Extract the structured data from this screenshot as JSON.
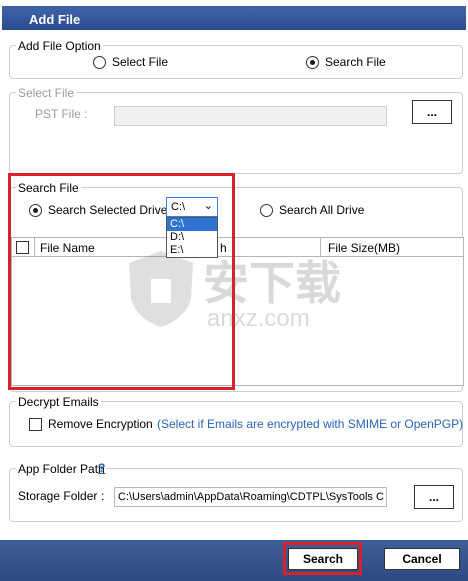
{
  "window": {
    "title": "Add File"
  },
  "add_file_option": {
    "legend": "Add File Option",
    "select_file_label": "Select File",
    "search_file_label": "Search File"
  },
  "select_file": {
    "legend": "Select File",
    "pst_label": "PST File :",
    "browse_label": "..."
  },
  "search_file": {
    "legend": "Search File",
    "search_selected_drive_label": "Search Selected Drive",
    "search_all_drive_label": "Search All Drive",
    "drive_selected": "C:\\",
    "drive_options": [
      "C:\\",
      "D:\\",
      "E:\\"
    ],
    "columns": {
      "file_name": "File Name",
      "col2": "h",
      "file_size": "File Size(MB)"
    }
  },
  "decrypt_emails": {
    "legend": "Decrypt Emails",
    "remove_encryption_label": "Remove Encryption",
    "note": "(Select if Emails are encrypted with SMIME or OpenPGP)"
  },
  "app_folder": {
    "legend": "App Folder Path",
    "help_mark": "?",
    "storage_label": "Storage Folder",
    "colon": ":",
    "path_value": "C:\\Users\\admin\\AppData\\Roaming\\CDTPL\\SysTools C",
    "browse_label": "..."
  },
  "buttons": {
    "search": "Search",
    "cancel": "Cancel"
  },
  "watermark": {
    "text_cn": "安下载",
    "text_en": "anxz.com"
  },
  "colors": {
    "title_bar": "#2b4d8f",
    "highlight": "#d8222a",
    "selection": "#2f74d0",
    "link": "#2b63b8"
  }
}
